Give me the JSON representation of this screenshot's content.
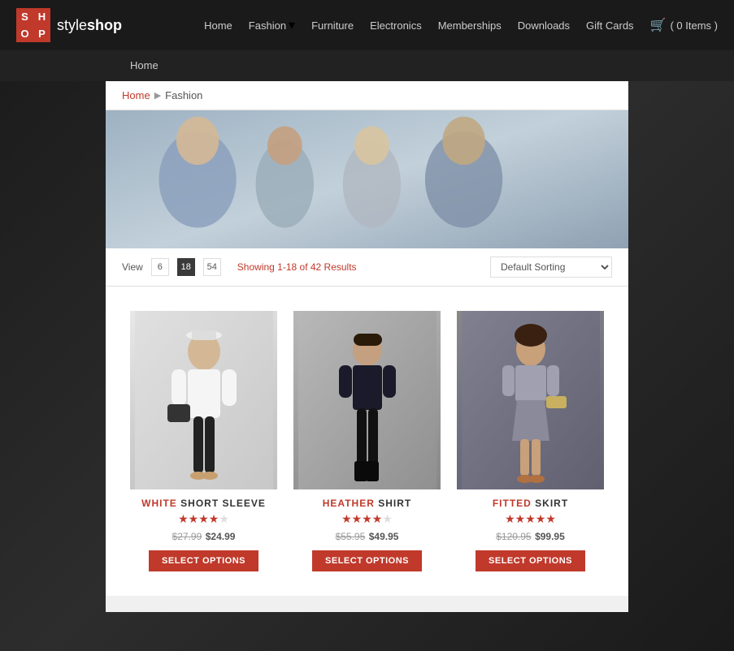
{
  "site": {
    "logo_letters": [
      "S",
      "H",
      "O",
      "P"
    ],
    "logo_style": "style",
    "logo_shop": "shop"
  },
  "header": {
    "nav": [
      {
        "label": "Home",
        "url": "#"
      },
      {
        "label": "Fashion",
        "url": "#",
        "has_dropdown": true
      },
      {
        "label": "Furniture",
        "url": "#"
      },
      {
        "label": "Electronics",
        "url": "#"
      },
      {
        "label": "Memberships",
        "url": "#"
      },
      {
        "label": "Downloads",
        "url": "#"
      },
      {
        "label": "Gift Cards",
        "url": "#"
      }
    ],
    "cart_label": "( 0 Items )"
  },
  "page_title_bar": {
    "label": "Home"
  },
  "breadcrumb": {
    "home": "Home",
    "current": "Fashion"
  },
  "toolbar": {
    "view_label": "View",
    "view_options": [
      "6",
      "18",
      "54"
    ],
    "active_view": "18",
    "results_text": "Showing 1-18 of 42 Results",
    "sort_label": "Default Sorting"
  },
  "products": [
    {
      "id": 1,
      "name_part1": "WHITE",
      "name_part2": "SHORT SLEEVE",
      "stars": 4,
      "max_stars": 5,
      "price_original": "$27.99",
      "price_sale": "$24.99",
      "btn_label": "Select Options",
      "image_class": "product-image-1"
    },
    {
      "id": 2,
      "name_part1": "HEATHER",
      "name_part2": "SHIRT",
      "stars": 4,
      "max_stars": 5,
      "price_original": "$55.95",
      "price_sale": "$49.95",
      "btn_label": "Select Options",
      "image_class": "product-image-2"
    },
    {
      "id": 3,
      "name_part1": "FITTED",
      "name_part2": "SKIRT",
      "stars": 5,
      "max_stars": 5,
      "price_original": "$120.95",
      "price_sale": "$99.95",
      "btn_label": "Select Options",
      "image_class": "product-image-3"
    }
  ],
  "colors": {
    "accent": "#c0392b",
    "dark_bg": "#1a1a1a",
    "text_muted": "#999"
  }
}
